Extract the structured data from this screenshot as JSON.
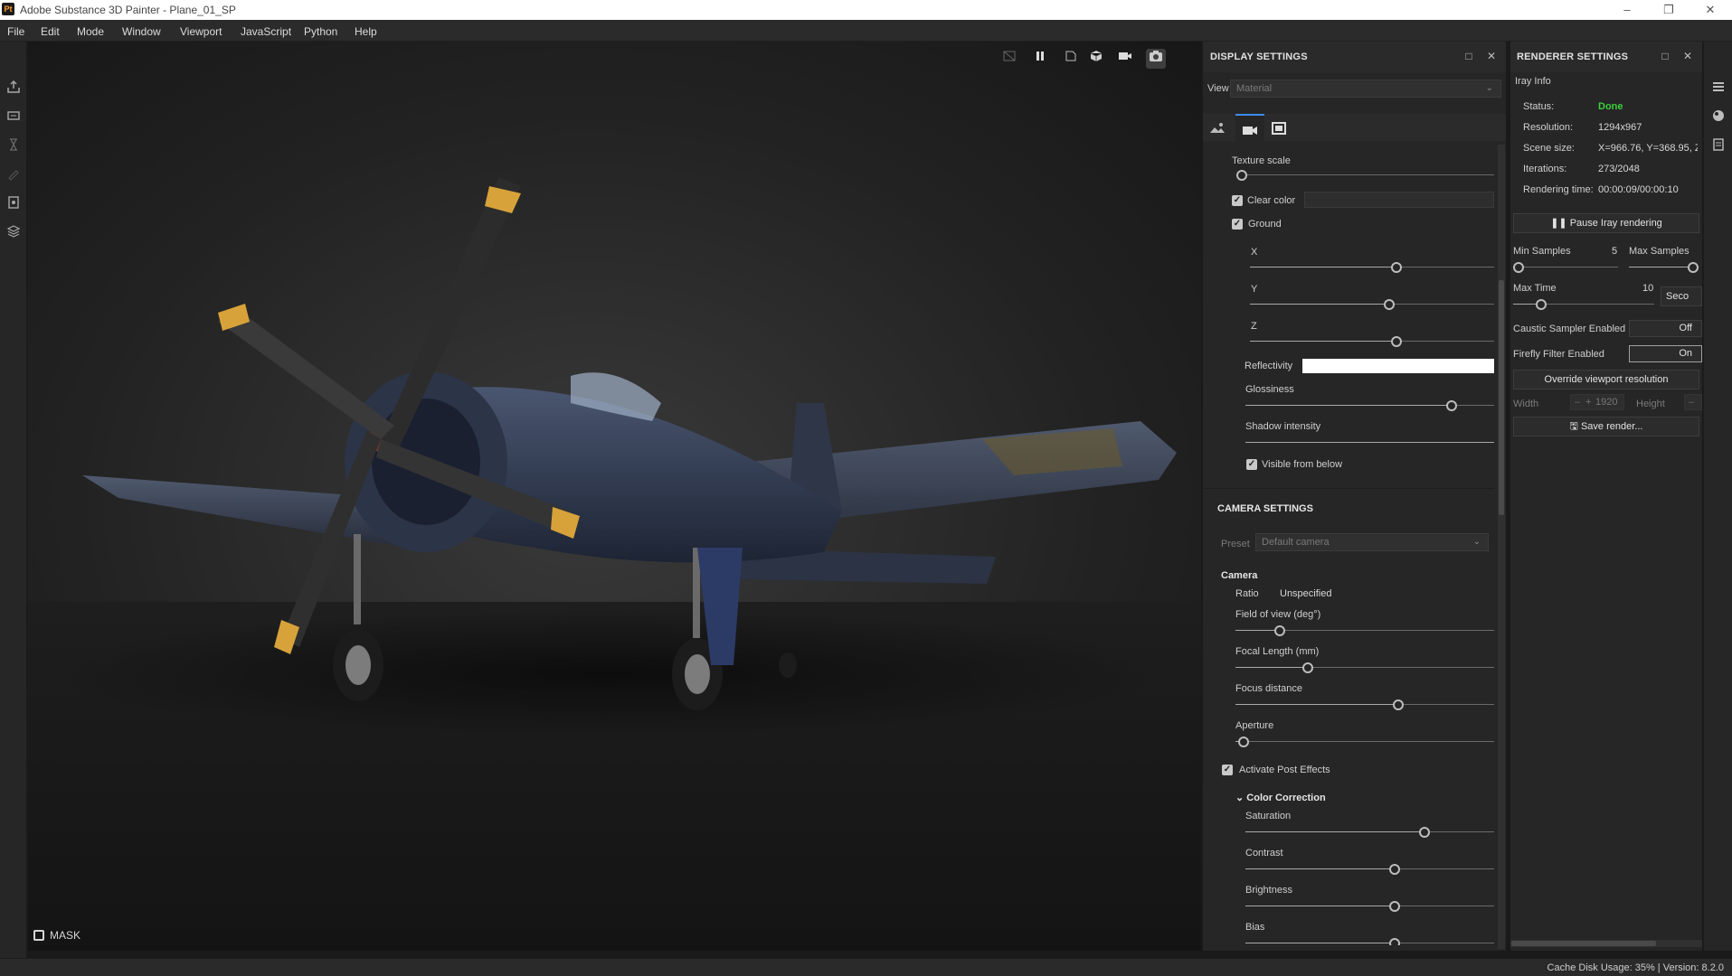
{
  "window": {
    "app_icon": "Pt",
    "title": "Adobe Substance 3D Painter - Plane_01_SP"
  },
  "menu": [
    "File",
    "Edit",
    "Mode",
    "Window",
    "Viewport",
    "JavaScript",
    "Python",
    "Help"
  ],
  "viewport": {
    "mask_label": "MASK",
    "toolbar_icons": [
      "screenshot-disabled-icon",
      "pause-icon",
      "frame-icon",
      "cube-view-icon",
      "camera-icon",
      "snapshot-icon"
    ]
  },
  "display_settings": {
    "title": "DISPLAY SETTINGS",
    "view_mode_label": "View mode",
    "view_mode_value": "Material",
    "tabs": [
      "environment-icon",
      "camera-icon",
      "frame-icon"
    ],
    "texture_scale_label": "Texture scale",
    "texture_scale": 0.02,
    "clear_color_label": "Clear color",
    "clear_color_checked": true,
    "ground_label": "Ground",
    "ground_checked": true,
    "x_label": "X",
    "x_value": 0.6,
    "y_label": "Y",
    "y_value": 0.57,
    "z_label": "Z",
    "z_value": 0.6,
    "reflectivity_label": "Reflectivity",
    "reflectivity_color": "#ffffff",
    "glossiness_label": "Glossiness",
    "glossiness": 0.83,
    "shadow_intensity_label": "Shadow intensity",
    "shadow_intensity": 1.0,
    "visible_from_below_label": "Visible from below",
    "visible_from_below_checked": true
  },
  "camera_settings": {
    "title": "CAMERA SETTINGS",
    "preset_label": "Preset",
    "preset_value": "Default camera",
    "camera_section": "Camera",
    "ratio_label": "Ratio",
    "ratio_value": "Unspecified",
    "fov_label": "Field of view (deg°)",
    "fov": 0.17,
    "focal_label": "Focal Length (mm)",
    "focal": 0.28,
    "focus_label": "Focus distance",
    "focus": 0.63,
    "aperture_label": "Aperture",
    "aperture": 0.03,
    "post_effects_label": "Activate Post Effects",
    "post_effects_checked": true,
    "color_correction_label": "Color Correction",
    "saturation_label": "Saturation",
    "saturation": 0.72,
    "contrast_label": "Contrast",
    "contrast": 0.6,
    "brightness_label": "Brightness",
    "brightness": 0.6,
    "bias_label": "Bias",
    "bias": 0.6
  },
  "renderer_settings": {
    "title": "RENDERER SETTINGS",
    "iray_info_label": "Iray Info",
    "status_label": "Status:",
    "status_value": "Done",
    "status_color": "#3ccf3c",
    "resolution_label": "Resolution:",
    "resolution_value": "1294x967",
    "scene_size_label": "Scene size:",
    "scene_size_value": "X=966.76, Y=368.95, Z",
    "iterations_label": "Iterations:",
    "iterations_value": "273/2048",
    "rendering_time_label": "Rendering time:",
    "rendering_time_value": "00:00:09/00:00:10",
    "pause_button": "Pause Iray rendering",
    "min_samples_label": "Min Samples",
    "min_samples_value": "5",
    "min_samples": 0.05,
    "max_samples_label": "Max Samples",
    "max_samples": 0.95,
    "max_time_label": "Max Time",
    "max_time_value": "10",
    "max_time": 0.2,
    "max_time_unit": "Seco",
    "caustic_label": "Caustic Sampler Enabled",
    "caustic_value": "Off",
    "firefly_label": "Firefly Filter Enabled",
    "firefly_value": "On",
    "override_button": "Override viewport resolution",
    "width_label": "Width",
    "width_value": "1920",
    "height_label": "Height",
    "save_button": "Save render..."
  },
  "right_strip_icons": [
    "layers-icon",
    "environment-icon",
    "properties-icon"
  ],
  "status_bar": {
    "text": "Cache Disk Usage:   35% | Version: 8.2.0"
  }
}
